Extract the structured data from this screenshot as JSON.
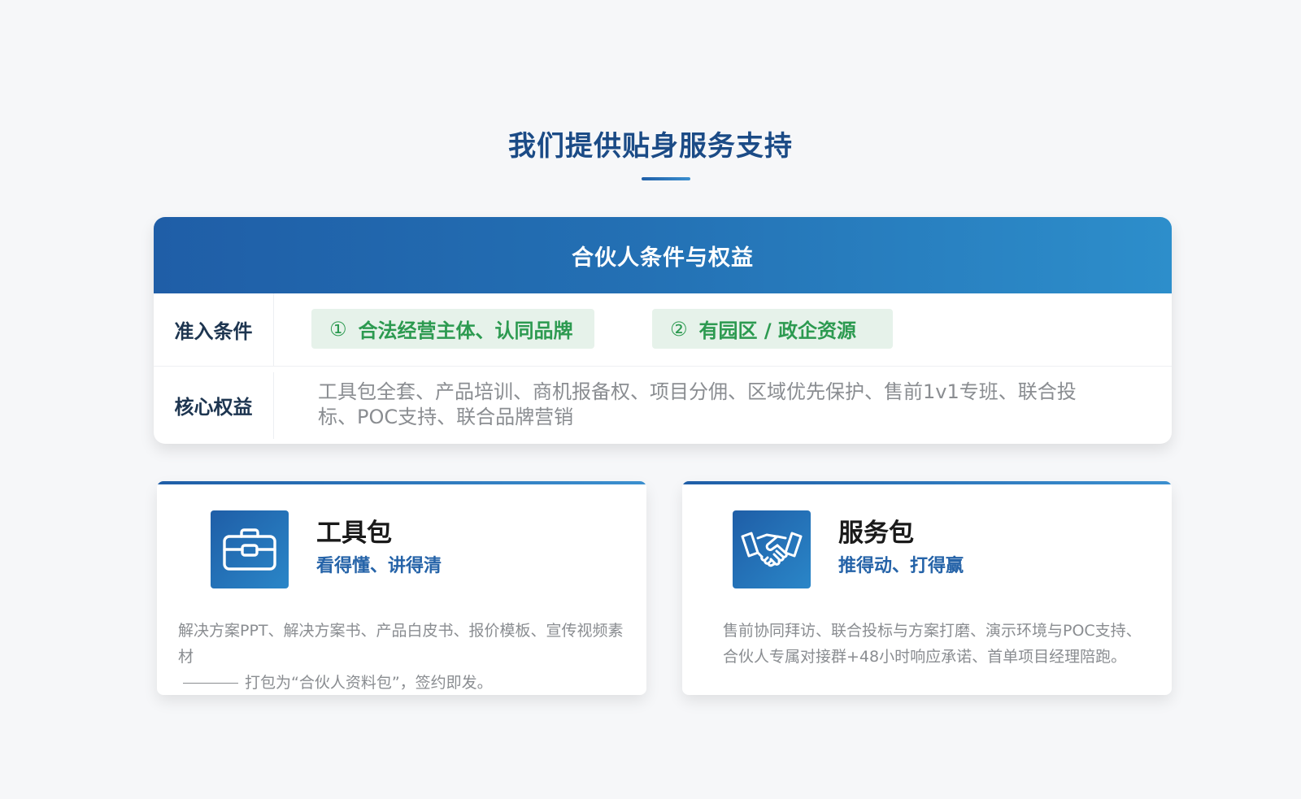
{
  "section": {
    "title": "我们提供贴身服务支持"
  },
  "partner": {
    "header_title": "合伙人条件与权益",
    "entry_label": "准入条件",
    "conditions": [
      {
        "num": "①",
        "text": "合法经营主体、认同品牌"
      },
      {
        "num": "②",
        "text": "有园区 / 政企资源"
      }
    ],
    "benefit_label": "核心权益",
    "benefits": "工具包全套、产品培训、商机报备权、项目分佣、区域优先保护、售前1v1专班、联合投标、POC支持、联合品牌营销"
  },
  "tools_pack": {
    "icon": "toolbox-icon",
    "title": "工具包",
    "subtitle": "看得懂、讲得清",
    "desc_line1": "解决方案PPT、解决方案书、产品白皮书、报价模板、宣传视频素材",
    "desc_line2": "打包为“合伙人资料包”，签约即发。"
  },
  "service_pack": {
    "icon": "handshake-icon",
    "title": "服务包",
    "subtitle": "推得动、打得赢",
    "desc_line1": "售前协同拜访、联合投标与方案打磨、演示环境与POC支持、",
    "desc_line2": "合伙人专属对接群+48小时响应承诺、首单项目经理陪跑。"
  },
  "colors": {
    "title_blue": "#1b4b86",
    "header_gradient_start": "#1f5ea7",
    "header_gradient_end": "#2d8ecb",
    "pill_bg": "#e6f2ea",
    "pill_text": "#2c9a50",
    "subtitle_blue": "#2563a8"
  }
}
